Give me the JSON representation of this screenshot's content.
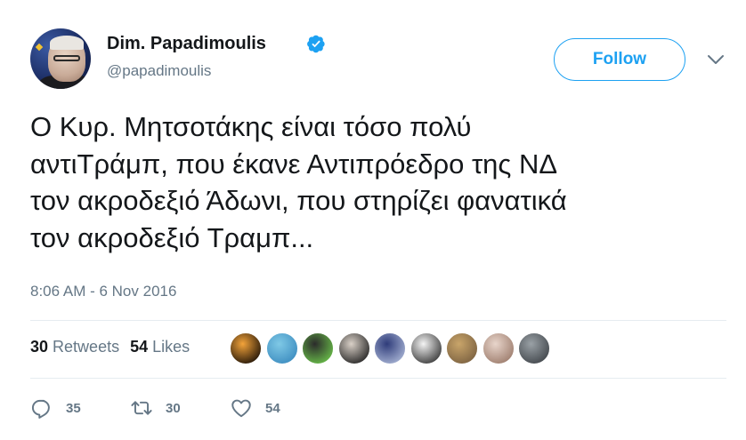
{
  "author": {
    "name": "Dim. Papadimoulis",
    "handle": "@papadimoulis",
    "verified_color": "#1da1f2"
  },
  "header": {
    "follow_label": "Follow",
    "more_icon": "chevron-down-icon"
  },
  "tweet": {
    "lines": [
      "Ο Κυρ. Μητσοτάκης είναι τόσο πολύ",
      "αντιΤράμπ, που έκανε Αντιπρόεδρο της ΝΔ",
      "τον ακροδεξιό Άδωνι, που στηρίζει φανατικά",
      "τον ακροδεξιό Τραμπ..."
    ],
    "timestamp": "8:06 AM - 6 Nov 2016"
  },
  "stats": {
    "retweets_count": "30",
    "retweets_label": "Retweets",
    "likes_count": "54",
    "likes_label": "Likes"
  },
  "likers": [
    {
      "name": "liker-avatar-1",
      "colors": [
        "#f3a33a",
        "#1a0f05"
      ]
    },
    {
      "name": "liker-avatar-2",
      "colors": [
        "#7fc9e6",
        "#3b8bbf"
      ]
    },
    {
      "name": "liker-avatar-3",
      "colors": [
        "#2b2b2b",
        "#6bc24a"
      ]
    },
    {
      "name": "liker-avatar-4",
      "colors": [
        "#d9d0c7",
        "#1f1f1f"
      ]
    },
    {
      "name": "liker-avatar-5",
      "colors": [
        "#2f3c7a",
        "#aab6d6"
      ]
    },
    {
      "name": "liker-avatar-6",
      "colors": [
        "#f4f4f4",
        "#333333"
      ]
    },
    {
      "name": "liker-avatar-7",
      "colors": [
        "#c9a56a",
        "#7a6040"
      ]
    },
    {
      "name": "liker-avatar-8",
      "colors": [
        "#e8d5cb",
        "#9b7a6a"
      ]
    },
    {
      "name": "liker-avatar-9",
      "colors": [
        "#9aa1a6",
        "#3f4449"
      ]
    }
  ],
  "actions": {
    "reply_count": "35",
    "retweet_count": "30",
    "like_count": "54",
    "icon_color": "#657786"
  }
}
